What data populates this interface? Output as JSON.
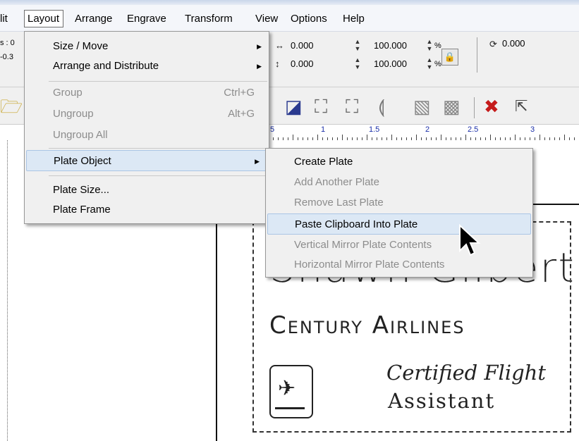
{
  "menubar": {
    "items": [
      "lit",
      "Layout",
      "Arrange",
      "Engrave",
      "Transform",
      "View",
      "Options",
      "Help"
    ]
  },
  "toolbar": {
    "left_labels": [
      "s : 0",
      "-0.3"
    ],
    "width_value": "0.000",
    "height_value": "0.000",
    "scale_w": "100.000",
    "scale_h": "100.000",
    "percent": "%",
    "rotation_value": "0.000"
  },
  "ruler": {
    "labels": [
      "5",
      "1",
      "1.5",
      "2",
      "2.5",
      "3"
    ]
  },
  "layout_menu": {
    "items": [
      {
        "label": "Size / Move",
        "shortcut": "",
        "submenu": true,
        "enabled": true
      },
      {
        "label": "Arrange and Distribute",
        "shortcut": "",
        "submenu": true,
        "enabled": true
      },
      {
        "label": "Group",
        "shortcut": "Ctrl+G",
        "submenu": false,
        "enabled": false
      },
      {
        "label": "Ungroup",
        "shortcut": "Alt+G",
        "submenu": false,
        "enabled": false
      },
      {
        "label": "Ungroup All",
        "shortcut": "",
        "submenu": false,
        "enabled": false
      },
      {
        "label": "Plate Object",
        "shortcut": "",
        "submenu": true,
        "enabled": true,
        "highlighted": true
      },
      {
        "label": "Plate Size...",
        "shortcut": "",
        "submenu": false,
        "enabled": true
      },
      {
        "label": "Plate Frame",
        "shortcut": "",
        "submenu": false,
        "enabled": true
      }
    ]
  },
  "plate_submenu": {
    "items": [
      {
        "label": "Create Plate",
        "enabled": true
      },
      {
        "label": "Add Another Plate",
        "enabled": false
      },
      {
        "label": "Remove Last Plate",
        "enabled": false
      },
      {
        "label": "Paste Clipboard Into Plate",
        "enabled": true,
        "highlighted": true
      },
      {
        "label": "Vertical Mirror Plate Contents",
        "enabled": false
      },
      {
        "label": "Horizontal Mirror Plate Contents",
        "enabled": false
      }
    ]
  },
  "plate": {
    "name_line": "Shawn Gilbert",
    "company_line": "Century Airlines",
    "title_line1": "Certified Flight",
    "title_line2": "Assistant"
  }
}
